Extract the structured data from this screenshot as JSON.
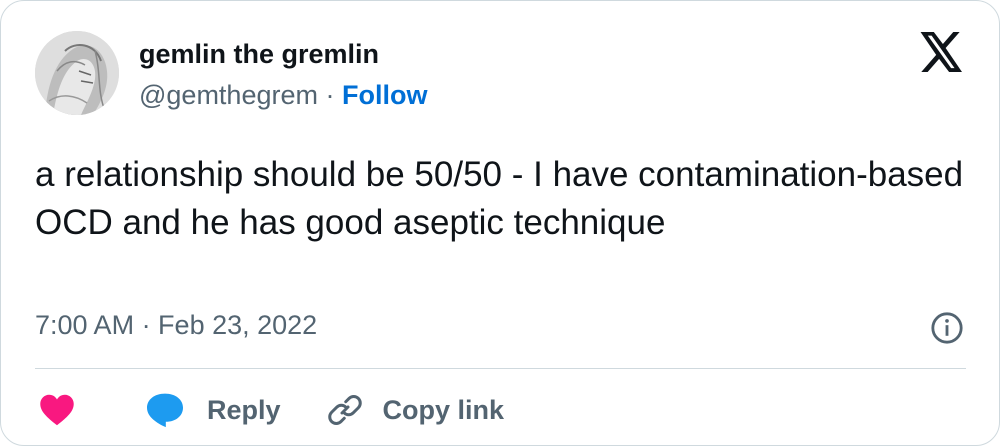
{
  "author": {
    "display_name": "gemlin the gremlin",
    "handle": "@gemthegrem",
    "separator": "·",
    "follow_label": "Follow"
  },
  "tweet": {
    "text": "a relationship should be 50/50 - I have contamination-based OCD and he has good aseptic technique",
    "timestamp": "7:00 AM · Feb 23, 2022"
  },
  "actions": {
    "reply_label": "Reply",
    "copy_link_label": "Copy link"
  },
  "icons": {
    "brand": "x-logo-icon",
    "info": "info-icon",
    "like": "heart-icon",
    "reply": "speech-bubble-icon",
    "copy": "link-icon"
  },
  "colors": {
    "link_blue": "#006fd6",
    "heart_pink": "#f91880",
    "reply_blue": "#1d9bf0",
    "secondary_text": "#536471",
    "border": "#cfd9de"
  }
}
